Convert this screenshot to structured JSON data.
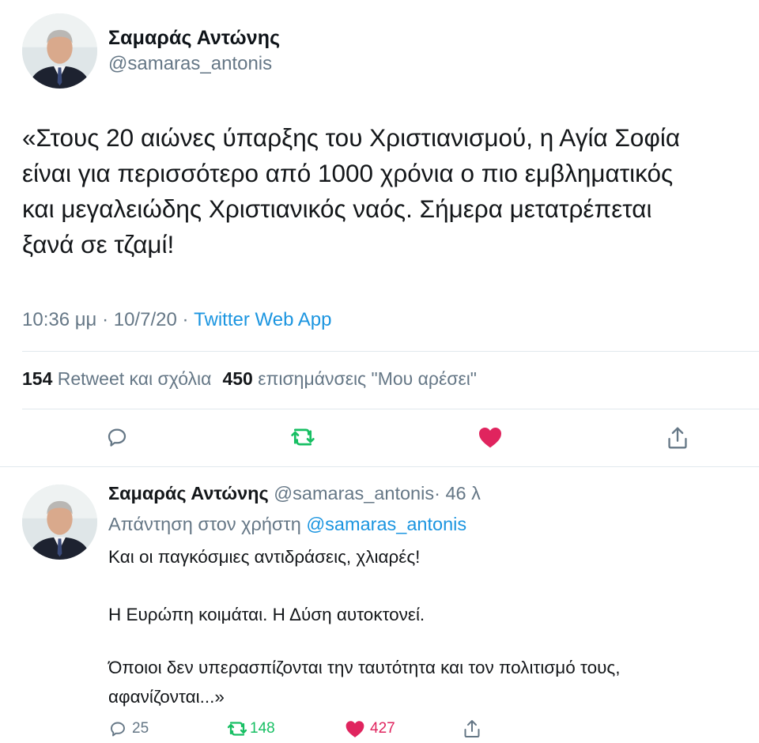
{
  "main_tweet": {
    "author_name": "Σαμαράς Αντώνης",
    "author_handle": "@samaras_antonis",
    "text_lines": [
      "«Στους 20 αιώνες ύπαρξης του Χριστιανισμού, η Αγία Σοφία",
      "είναι για περισσότερο από 1000 χρόνια ο πιο εμβληματικός",
      "και μεγαλειώδης Χριστιανικός ναός. Σήμερα μετατρέπεται",
      "ξανά σε τζαμί!"
    ],
    "time": "10:36 μμ",
    "date": "10/7/20",
    "separator": "·",
    "source": "Twitter Web App",
    "retweets_count": "154",
    "retweets_label": "Retweet και σχόλια",
    "likes_count": "450",
    "likes_label": "επισημάνσεις \"Μου αρέσει\"",
    "actions": {
      "reply_icon": "reply-bubble-icon",
      "retweet_icon": "retweet-icon",
      "like_icon": "heart-icon",
      "share_icon": "share-icon"
    }
  },
  "reply_tweet": {
    "author_name": "Σαμαράς Αντώνης",
    "author_handle": "@samaras_antonis",
    "dot": "·",
    "age": "46 λ",
    "replying_to_label": "Απάντηση στον χρήστη",
    "replying_to_handle": "@samaras_antonis",
    "text_lines": [
      "Και οι παγκόσμιες αντιδράσεις, χλιαρές!",
      "Η Ευρώπη κοιμάται. Η Δύση αυτοκτονεί.",
      "Όποιοι δεν υπερασπίζονται την ταυτότητα και τον πολιτισμό τους,",
      "αφανίζονται...»"
    ],
    "reply_count": "25",
    "retweet_count": "148",
    "like_count": "427"
  },
  "colors": {
    "retweet_green": "#17bf63",
    "like_red": "#e0245e",
    "link_blue": "#1b95e0",
    "secondary_gray": "#657786"
  }
}
